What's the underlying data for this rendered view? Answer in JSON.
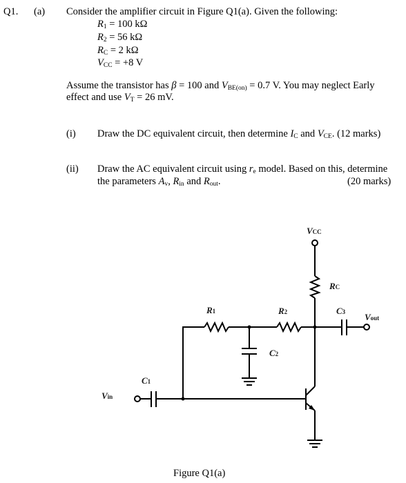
{
  "question": {
    "number": "Q1.",
    "part": "(a)",
    "intro": "Consider the amplifier circuit in Figure Q1(a). Given the following:",
    "givens": [
      {
        "symbol": "R",
        "sub": "1",
        "value": "= 100 kΩ"
      },
      {
        "symbol": "R",
        "sub": "2",
        "value": "= 56 kΩ"
      },
      {
        "symbol": "R",
        "sub": "C",
        "value": "= 2 kΩ"
      },
      {
        "symbol": "V",
        "sub": "CC",
        "value": "= +8 V"
      }
    ],
    "assumption": {
      "t1": "Assume the transistor has ",
      "beta": "β",
      "t2": " = 100 and ",
      "vbe": "V",
      "vbe_sub": "BE(on)",
      "t3": " = 0.7 V. You may neglect Early",
      "t4": "effect and use ",
      "vt": "V",
      "vt_sub": "T",
      "t5": " = 26 mV."
    },
    "subparts": [
      {
        "label": "(i)",
        "t1": "Draw the DC equivalent circuit, then determine ",
        "ic": "I",
        "ic_sub": "C",
        "t2": " and ",
        "vce": "V",
        "vce_sub": "CE",
        "t3": ". (12 marks)"
      },
      {
        "label": "(ii)",
        "t1": "Draw the AC equivalent circuit using ",
        "re": "r",
        "re_sub": "e",
        "t2": " model. Based on this, determine",
        "t3": "the parameters ",
        "av": "A",
        "av_sub": "v",
        "t4": ", ",
        "rin": "R",
        "rin_sub": "in",
        "t5": " and ",
        "rout": "R",
        "rout_sub": "out",
        "t6": ".",
        "marks": "(20 marks)"
      }
    ]
  },
  "figure": {
    "caption": "Figure Q1(a)",
    "labels": {
      "vcc": {
        "main": "V",
        "sub": "CC"
      },
      "rc": {
        "main": "R",
        "sub": "C"
      },
      "r1": {
        "main": "R",
        "sub": "1"
      },
      "r2": {
        "main": "R",
        "sub": "2"
      },
      "c1": {
        "main": "C",
        "sub": "1"
      },
      "c2": {
        "main": "C",
        "sub": "2"
      },
      "c3": {
        "main": "C",
        "sub": "3"
      },
      "vin": {
        "main": "V",
        "sub": "in"
      },
      "vout": {
        "main": "V",
        "sub": "out"
      }
    }
  }
}
